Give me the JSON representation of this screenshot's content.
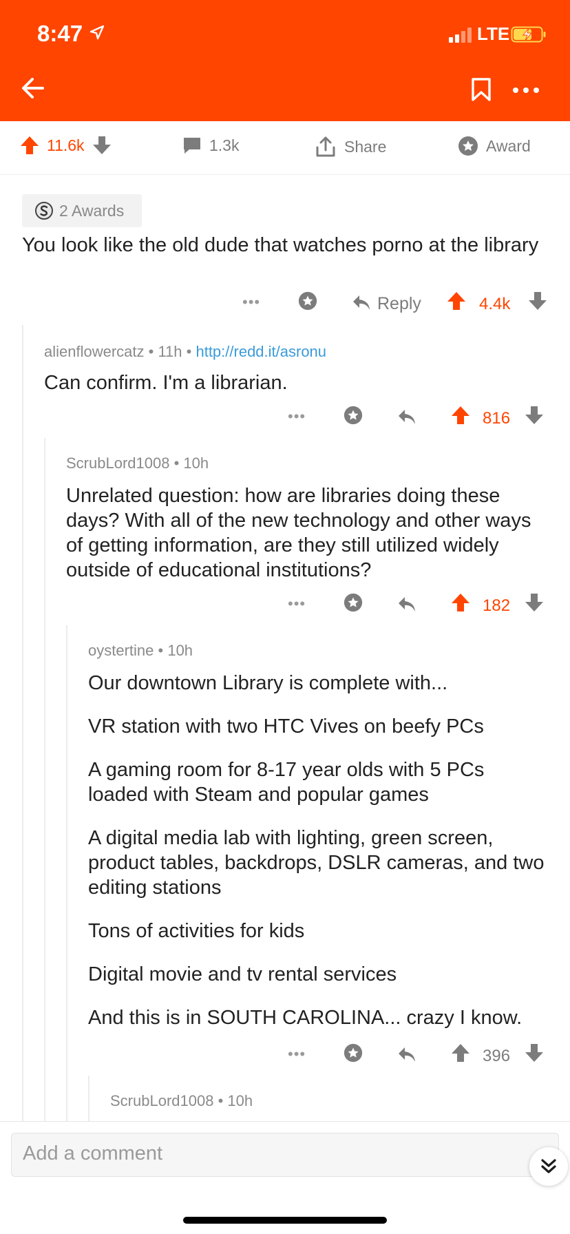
{
  "status_bar": {
    "time": "8:47",
    "network": "LTE"
  },
  "colors": {
    "brand": "#ff4500",
    "link": "#3a9bd9",
    "muted": "#7c7c7c"
  },
  "post_actions": {
    "upvotes": "11.6k",
    "comments": "1.3k",
    "share_label": "Share",
    "award_label": "Award"
  },
  "top_comment": {
    "awards_label": "2 Awards",
    "body": "You look like the old dude that watches porno at the library",
    "reply_label": "Reply",
    "score": "4.4k"
  },
  "comments": [
    {
      "author": "alienflowercatz",
      "age": "11h",
      "link": "http://redd.it/asronu",
      "body": [
        "Can confirm. I'm a librarian."
      ],
      "score": "816"
    },
    {
      "author": "ScrubLord1008",
      "age": "10h",
      "body": [
        "Unrelated question: how are libraries doing these days? With all of the new technology and other ways of getting information, are they still utilized widely outside of educational institutions?"
      ],
      "score": "182"
    },
    {
      "author": "oystertine",
      "age": "10h",
      "body": [
        "Our downtown Library is complete with...",
        "VR station with two HTC Vives on beefy PCs",
        "A gaming room for 8-17 year olds with 5 PCs loaded with Steam and popular games",
        "A digital media lab with lighting, green screen, product tables, backdrops, DSLR cameras, and two editing stations",
        "Tons of activities for kids",
        "Digital movie and tv rental services",
        "And this is in SOUTH CAROLINA... crazy I know."
      ],
      "score": "396"
    },
    {
      "author": "ScrubLord1008",
      "age": "10h"
    }
  ],
  "bottom_bar": {
    "comment_placeholder": "Add a comment"
  }
}
